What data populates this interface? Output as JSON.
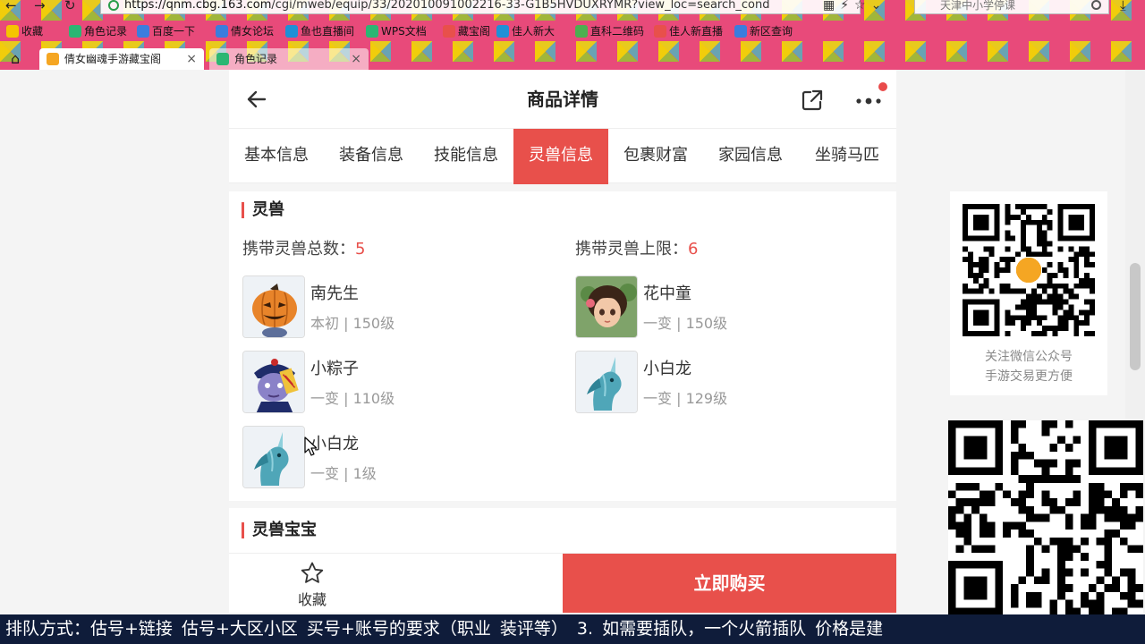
{
  "browser": {
    "url_host": "https://qnm.cbg.163.com",
    "url_path": "/cgi/mweb/equip/33/202010091002216-33-G1B5HVDUXRYMR?view_loc=search_cond",
    "search_text": "天津中小学停课",
    "bookmarks": [
      "收藏",
      "角色记录",
      "百度一下",
      "倩女论坛",
      "鱼也直播间",
      "WPS文档",
      "藏宝阁",
      "佳人新大",
      "直科二维码",
      "佳人新直播",
      "新区查询"
    ],
    "tabs": [
      {
        "label": "倩女幽魂手游藏宝阁"
      },
      {
        "label": "角色记录"
      }
    ]
  },
  "page": {
    "title": "商品详情",
    "tabs": [
      "基本信息",
      "装备信息",
      "技能信息",
      "灵兽信息",
      "包裹财富",
      "家园信息",
      "坐骑马匹"
    ],
    "active_tab": "灵兽信息",
    "section_title": "灵兽",
    "total_label": "携带灵兽总数：",
    "total_value": "5",
    "limit_label": "携带灵兽上限：",
    "limit_value": "6",
    "beasts": [
      {
        "name": "南先生",
        "sub": "本初 | 150级"
      },
      {
        "name": "花中童",
        "sub": "一变 | 150级"
      },
      {
        "name": "小粽子",
        "sub": "一变 | 110级"
      },
      {
        "name": "小白龙",
        "sub": "一变 | 129级"
      },
      {
        "name": "小白龙",
        "sub": "一变 | 1级"
      }
    ],
    "section2_title": "灵兽宝宝",
    "fav_label": "收藏",
    "buy_label": "立即购买"
  },
  "qr": {
    "line1": "关注微信公众号",
    "line2": "手游交易更方便"
  },
  "ticker": "排队方式：估号+链接    估号+大区小区    买号+账号的要求（职业  装评等）    3. 如需要插队，一个火箭插队  价格是建"
}
